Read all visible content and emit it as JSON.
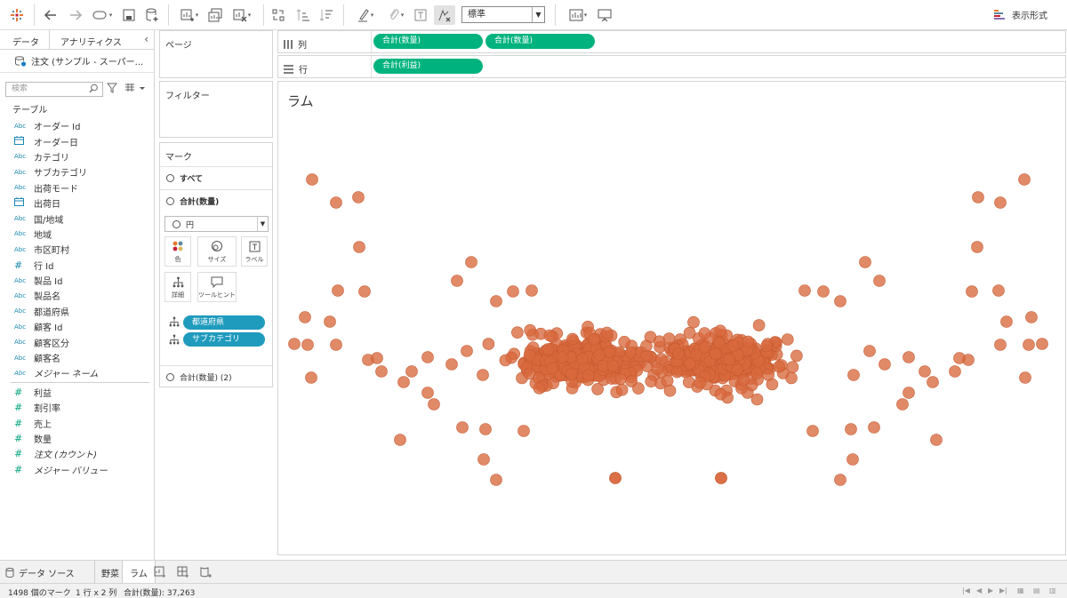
{
  "toolbar": {
    "fit_value": "標準",
    "show_me_label": "表示形式"
  },
  "left_pane": {
    "tab_data": "データ",
    "tab_analytics": "アナリティクス",
    "collapse_glyph": "‹",
    "datasource": "注文 (サンプル - スーパー...",
    "search_placeholder": "検索",
    "table_section": "テーブル",
    "dimensions": [
      {
        "type": "Abc",
        "label": "オーダー Id"
      },
      {
        "type": "date",
        "label": "オーダー日"
      },
      {
        "type": "Abc",
        "label": "カテゴリ"
      },
      {
        "type": "Abc",
        "label": "サブカテゴリ"
      },
      {
        "type": "Abc",
        "label": "出荷モード"
      },
      {
        "type": "date",
        "label": "出荷日"
      },
      {
        "type": "Abc",
        "label": "国/地域"
      },
      {
        "type": "Abc",
        "label": "地域"
      },
      {
        "type": "Abc",
        "label": "市区町村"
      },
      {
        "type": "#",
        "label": "行 Id"
      },
      {
        "type": "Abc",
        "label": "製品 Id"
      },
      {
        "type": "Abc",
        "label": "製品名"
      },
      {
        "type": "Abc",
        "label": "都道府県"
      },
      {
        "type": "Abc",
        "label": "顧客 Id"
      },
      {
        "type": "Abc",
        "label": "顧客区分"
      },
      {
        "type": "Abc",
        "label": "顧客名"
      },
      {
        "type": "Abc",
        "label": "メジャー ネーム",
        "italic": true
      }
    ],
    "measures": [
      {
        "type": "#",
        "label": "利益"
      },
      {
        "type": "#",
        "label": "割引率"
      },
      {
        "type": "#",
        "label": "売上"
      },
      {
        "type": "#",
        "label": "数量"
      },
      {
        "type": "#",
        "label": "注文 (カウント)",
        "italic": true
      },
      {
        "type": "#",
        "label": "メジャー バリュー",
        "italic": true
      }
    ]
  },
  "cards": {
    "pages": "ページ",
    "filters": "フィルター",
    "marks": "マーク",
    "marks_all": "すべて",
    "marks_sum_qty": "合計(数量)",
    "mark_type": "円",
    "btn_color": "色",
    "btn_size": "サイズ",
    "btn_label": "ラベル",
    "btn_detail": "詳細",
    "btn_tooltip": "ツールヒント",
    "pill_prefecture": "都道府県",
    "pill_subcategory": "サブカテゴリ",
    "marks_sum_qty2": "合計(数量) (2)"
  },
  "shelves": {
    "columns_label": "列",
    "rows_label": "行",
    "col_pill1": "合計(数量)",
    "col_pill2": "合計(数量)",
    "row_pill": "合計(利益)"
  },
  "view": {
    "title": "ラム",
    "mark_color": "#d9693e"
  },
  "tabs": {
    "datasource": "データ ソース",
    "sheet1": "野菜",
    "sheet2": "ラム"
  },
  "status": {
    "marks": "1498 個のマーク",
    "rows_cols": "1 行 x 2 列",
    "sum": "合計(数量): 37,263"
  }
}
